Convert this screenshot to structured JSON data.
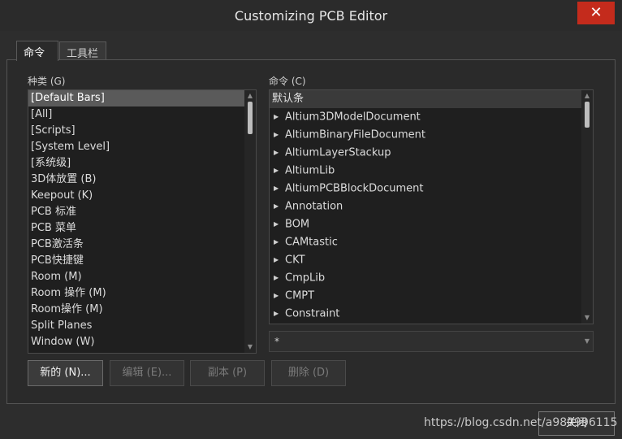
{
  "window": {
    "title": "Customizing PCB Editor",
    "close_glyph": "✕"
  },
  "tabs": [
    {
      "label": "命令",
      "active": true
    },
    {
      "label": "工具栏",
      "active": false
    }
  ],
  "categories": {
    "label": "种类 (G)",
    "selected_index": 0,
    "items": [
      "[Default Bars]",
      "[All]",
      "[Scripts]",
      "[System Level]",
      "[系统级]",
      "3D体放置 (B)",
      "Keepout (K)",
      "PCB 标准",
      "PCB 菜单",
      "PCB激活条",
      "PCB快捷键",
      "Room (M)",
      "Room 操作 (M)",
      "Room操作 (M)",
      "Split Planes",
      "Window (W)"
    ]
  },
  "commands": {
    "label": "命令 (C)",
    "header": "默认条",
    "items": [
      "Altium3DModelDocument",
      "AltiumBinaryFileDocument",
      "AltiumLayerStackup",
      "AltiumLib",
      "AltiumPCBBlockDocument",
      "Annotation",
      "BOM",
      "CAMtastic",
      "CKT",
      "CmpLib",
      "CMPT",
      "Constraint"
    ],
    "filter_value": "*"
  },
  "buttons": {
    "new": "新的 (N)...",
    "edit": "编辑 (E)...",
    "copy": "副本 (P)",
    "delete": "删除 (D)",
    "close": "关闭"
  },
  "watermark": "https://blog.csdn.net/a980996115",
  "colors": {
    "close_button": "#c42b1c",
    "background": "#2d2d2d",
    "selection": "#5a5a5a"
  }
}
